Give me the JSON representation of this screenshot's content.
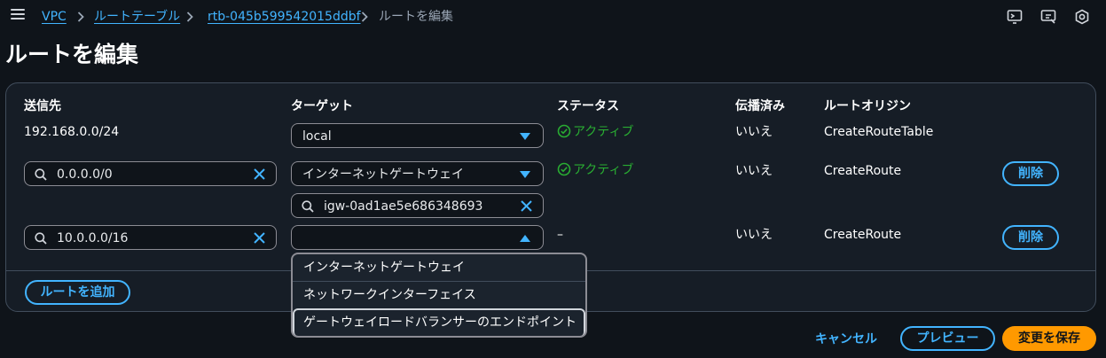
{
  "breadcrumb": {
    "items": [
      "VPC",
      "ルートテーブル",
      "rtb-045b599542015ddbf"
    ],
    "current": "ルートを編集"
  },
  "page_title": "ルートを編集",
  "columns": {
    "destination": "送信先",
    "target": "ターゲット",
    "status": "ステータス",
    "propagated": "伝播済み",
    "origin": "ルートオリジン"
  },
  "routes": [
    {
      "destination": "192.168.0.0/24",
      "target": "local",
      "status": "アクティブ",
      "propagated": "いいえ",
      "origin": "CreateRouteTable"
    },
    {
      "destination": "0.0.0.0/0",
      "target": "インターネットゲートウェイ",
      "target_value": "igw-0ad1ae5e686348693",
      "status": "アクティブ",
      "propagated": "いいえ",
      "origin": "CreateRoute",
      "remove": "削除"
    },
    {
      "destination": "10.0.0.0/16",
      "target": "",
      "status": "–",
      "propagated": "いいえ",
      "origin": "CreateRoute",
      "remove": "削除"
    }
  ],
  "dropdown_options": [
    "インターネットゲートウェイ",
    "ネットワークインターフェイス",
    "ゲートウェイロードバランサーのエンドポイント"
  ],
  "add_route": "ルートを追加",
  "footer": {
    "cancel": "キャンセル",
    "preview": "プレビュー",
    "save": "変更を保存"
  },
  "colors": {
    "accent": "#42b4ff",
    "success": "#29ad32",
    "primary": "#ff9900",
    "background": "#0f141a"
  }
}
